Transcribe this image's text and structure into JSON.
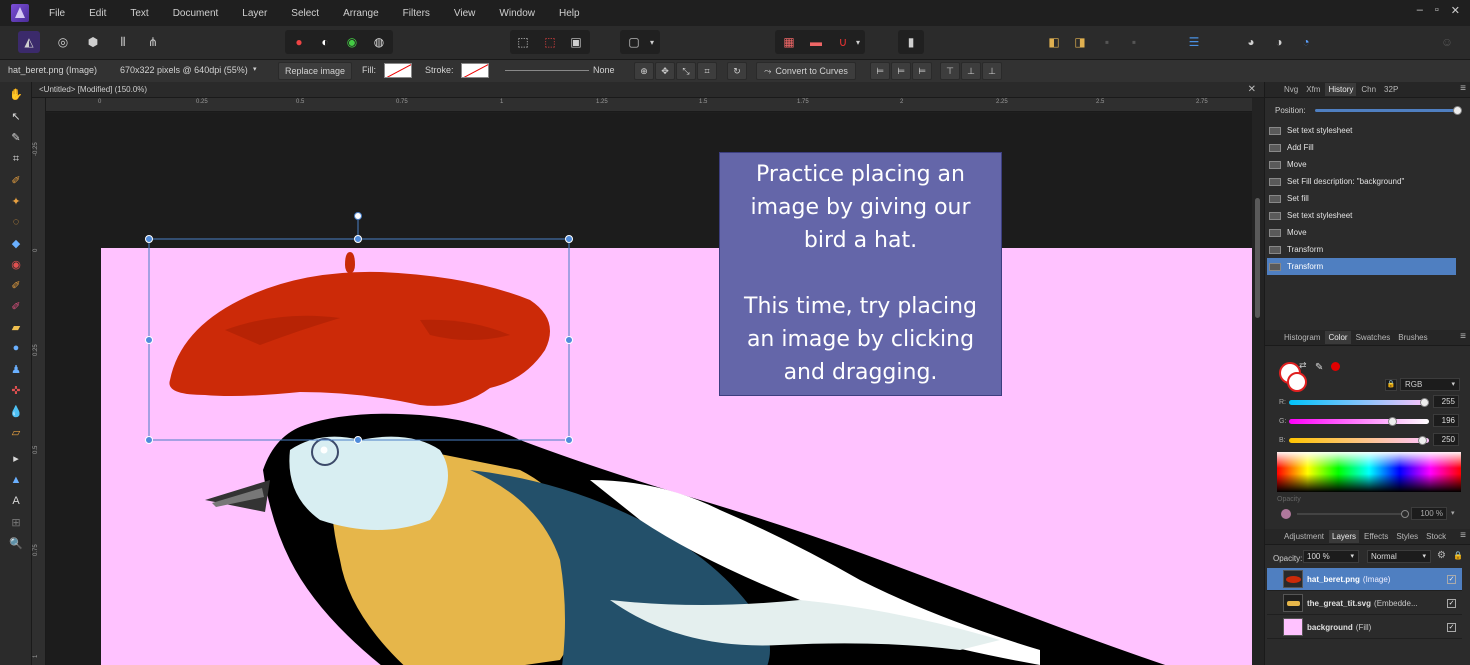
{
  "menubar": {
    "items": [
      "File",
      "Edit",
      "Text",
      "Document",
      "Layer",
      "Select",
      "Arrange",
      "Filters",
      "View",
      "Window",
      "Help"
    ],
    "window_controls": [
      "–",
      "▫",
      "✕"
    ]
  },
  "context": {
    "filename": "hat_beret.png (Image)",
    "dimensions": "670x322 pixels @ 640dpi (55%)",
    "replace_image": "Replace image",
    "fill_label": "Fill:",
    "stroke_label": "Stroke:",
    "stroke_style": "None",
    "convert_to_curves": "Convert to Curves"
  },
  "document": {
    "tab_title": "<Untitled> [Modified] (150.0%)",
    "ruler_h_labels": [
      "0",
      "0.25",
      "0.5",
      "0.75",
      "1",
      "1.25",
      "1.5",
      "1.75",
      "2",
      "2.25",
      "2.5",
      "2.75"
    ],
    "ruler_v_labels": [
      "-0.25",
      "0",
      "0.25",
      "0.5",
      "0.75",
      "1"
    ],
    "artboard_color": "#ffc2ff"
  },
  "callout": {
    "line1": "Practice placing an",
    "line2": "image by giving our",
    "line3": "bird a hat.",
    "line4": "This time, try placing",
    "line5": "an image by clicking",
    "line6": "and dragging.",
    "background": "#6466a9"
  },
  "panels": {
    "top_tabs": [
      "Nvg",
      "Xfm",
      "History",
      "Chn",
      "32P"
    ],
    "history_position_label": "Position:",
    "history": [
      "Set text stylesheet",
      "Add Fill",
      "Move",
      "Set Fill description: \"background\"",
      "Set fill",
      "Set text stylesheet",
      "Move",
      "Transform",
      "Transform"
    ],
    "history_selected_index": 8,
    "color_tabs": [
      "Histogram",
      "Color",
      "Swatches",
      "Brushes"
    ],
    "color_model": "RGB",
    "r_label": "R:",
    "r_value": "255",
    "g_label": "G:",
    "g_value": "196",
    "b_label": "B:",
    "b_value": "250",
    "opacity_label": "Opacity",
    "opacity_value": "100 %",
    "layers_tabs": [
      "Adjustment",
      "Layers",
      "Effects",
      "Styles",
      "Stock"
    ],
    "layers_opacity_label": "Opacity:",
    "layers_opacity_value": "100 %",
    "blend_mode": "Normal",
    "layers": [
      {
        "name": "hat_beret.png",
        "type": "(Image)"
      },
      {
        "name": "the_great_tit.svg",
        "type": "(Embedde..."
      },
      {
        "name": "background",
        "type": "(Fill)"
      }
    ]
  },
  "colors": {
    "selection": "#4f7fc1",
    "accent_red": "#e00000"
  }
}
